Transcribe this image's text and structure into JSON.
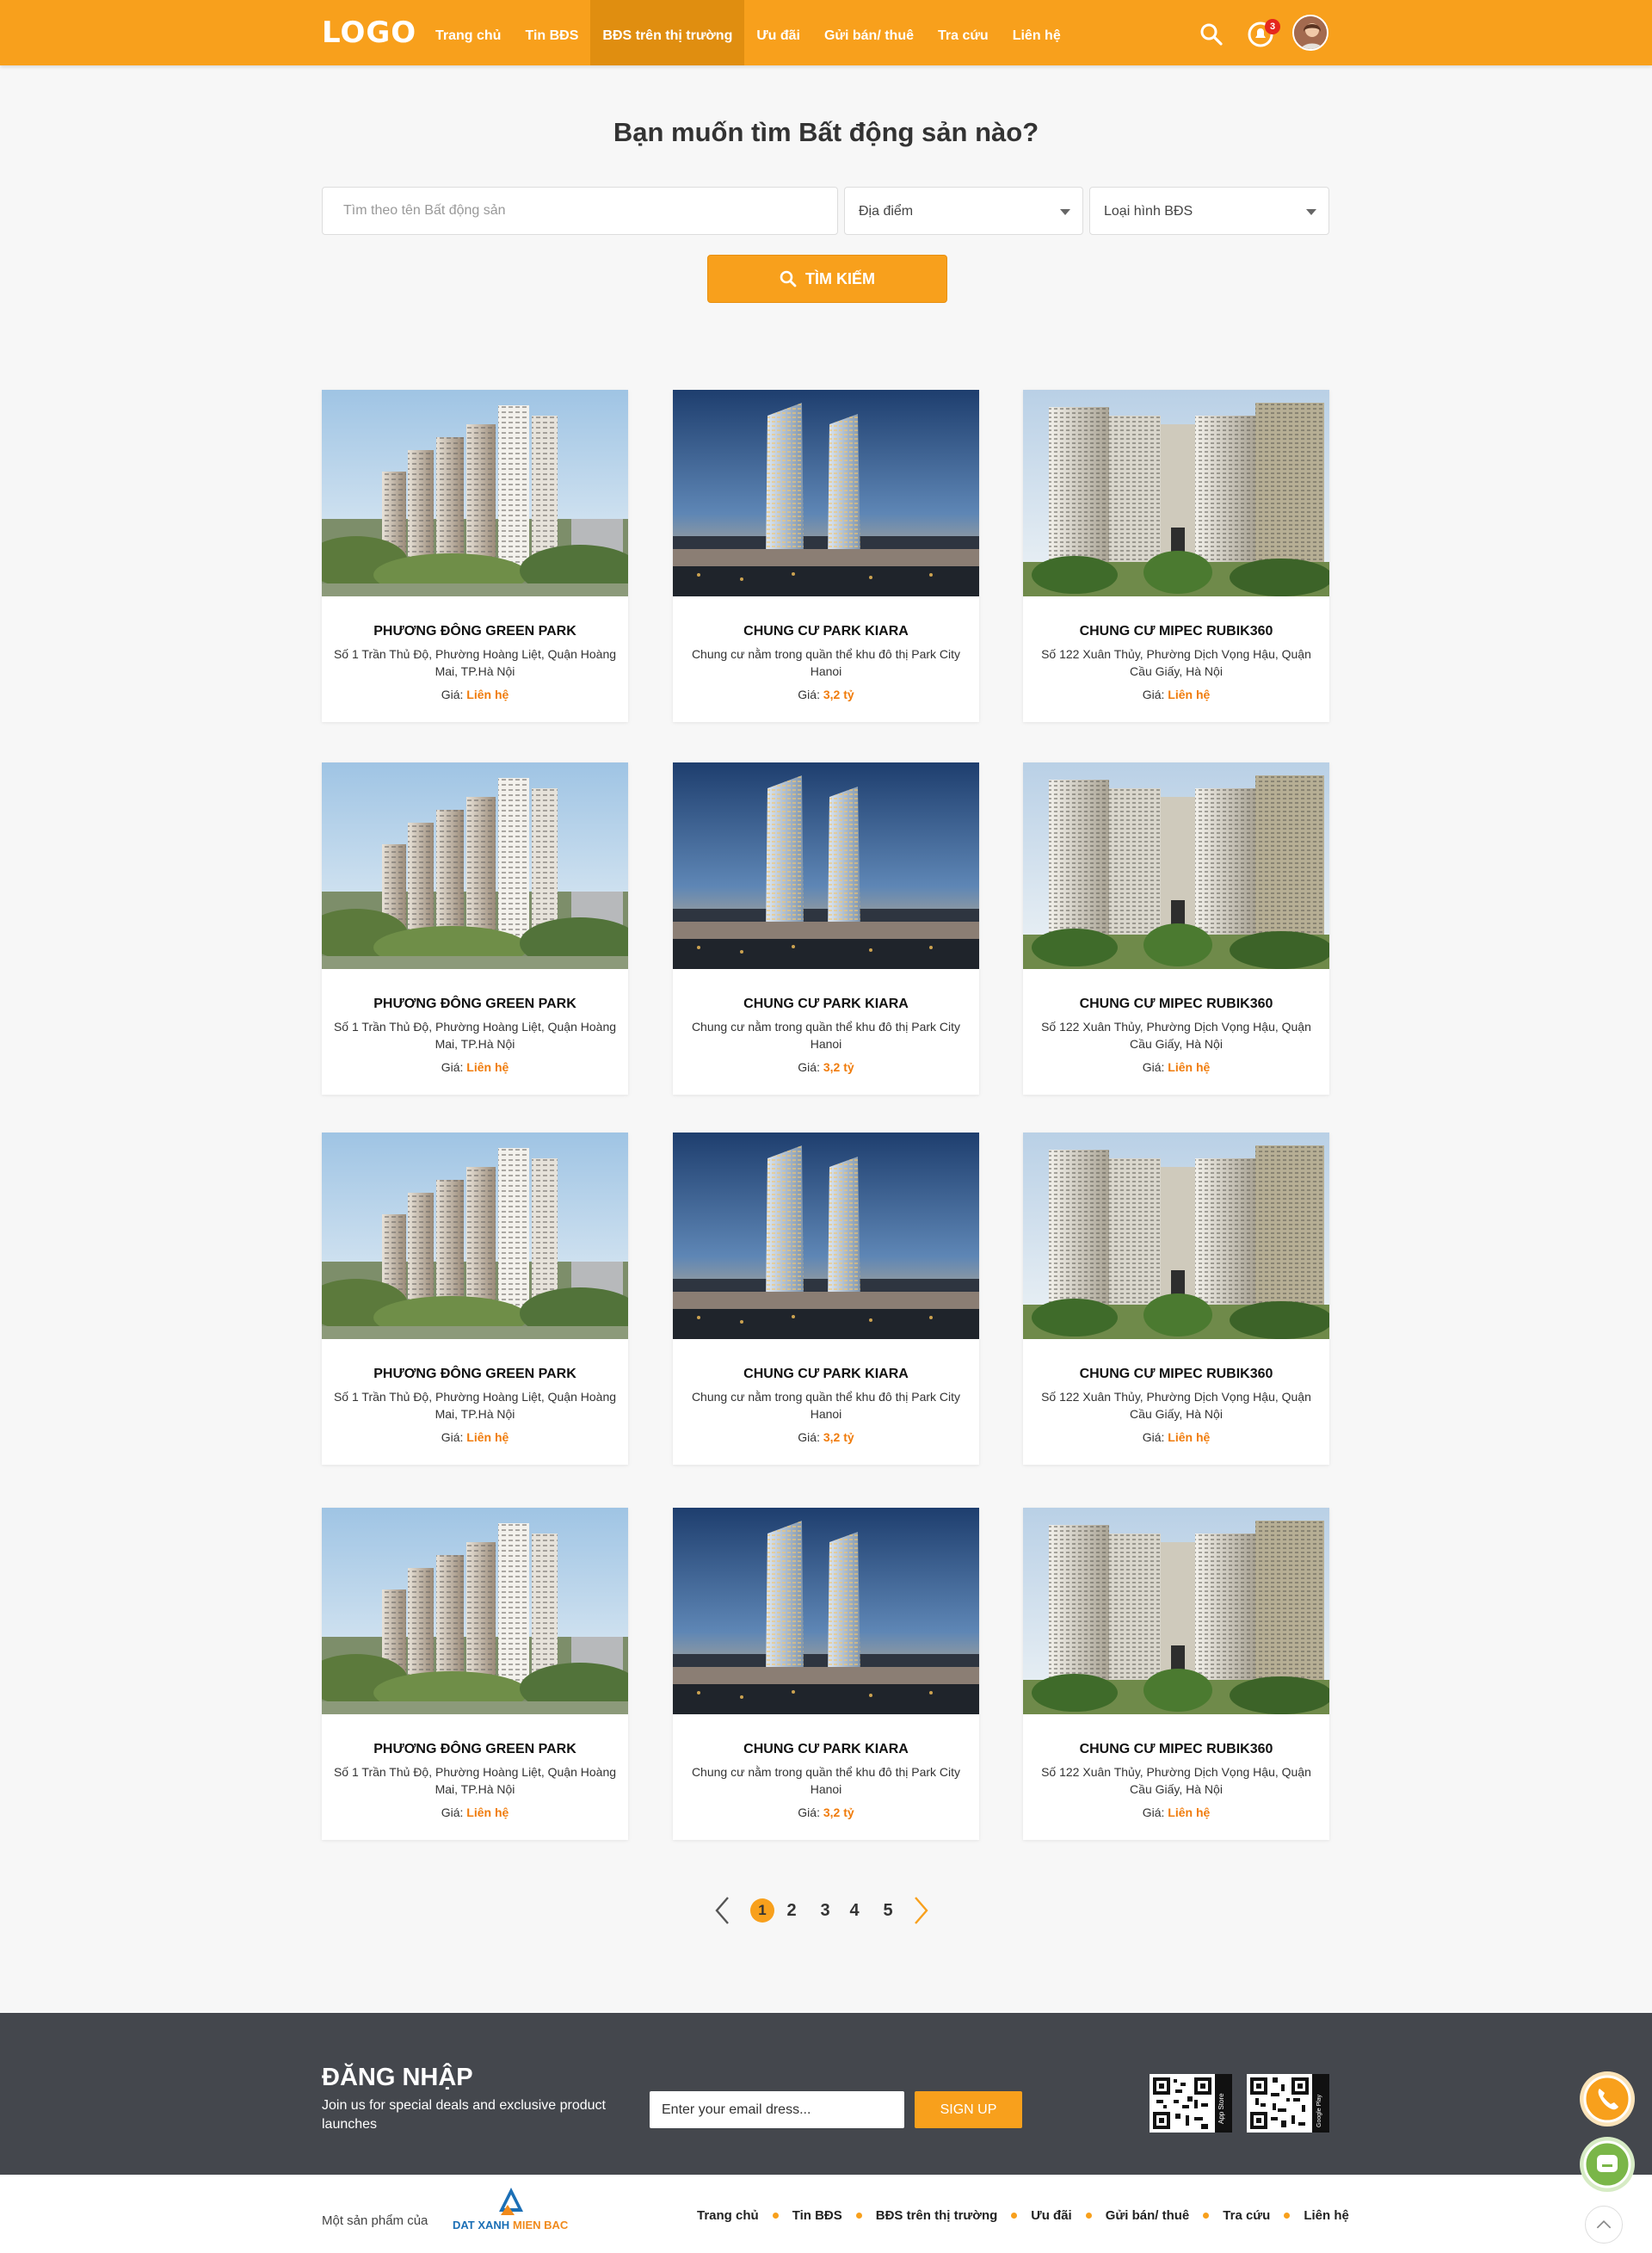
{
  "header": {
    "logo": "LOGO",
    "nav": [
      "Trang chủ",
      "Tin BĐS",
      "BĐS trên thị trường",
      "Ưu đãi",
      "Gửi bán/ thuê",
      "Tra cứu",
      "Liên hệ"
    ],
    "active_nav": "BĐS trên thị trường",
    "notification_count": "3"
  },
  "search": {
    "title": "Bạn muốn tìm Bất động sản nào?",
    "placeholder": "Tìm theo tên Bất động sản",
    "location_select": "Địa điểm",
    "type_select": "Loại hình BĐS",
    "button_label": "TÌM KIẾM"
  },
  "listings": [
    {
      "name": "PHƯƠNG ĐÔNG GREEN PARK",
      "desc": "Số 1 Trần Thủ Độ, Phường Hoàng Liệt, Quận Hoàng Mai, TP.Hà Nội",
      "price_label": "Giá:",
      "price": "Liên hệ"
    },
    {
      "name": "CHUNG CƯ PARK KIARA",
      "desc": "Chung cư nằm trong quần thể khu đô thị Park City Hanoi",
      "price_label": "Giá:",
      "price": "3,2 tỷ"
    },
    {
      "name": "CHUNG CƯ MIPEC RUBIK360",
      "desc": "Số 122 Xuân Thủy, Phường Dịch Vọng Hậu, Quận Cầu Giấy, Hà Nội",
      "price_label": "Giá:",
      "price": "Liên hệ"
    },
    {
      "name": "PHƯƠNG ĐÔNG GREEN PARK",
      "desc": "Số 1 Trần Thủ Độ, Phường Hoàng Liệt, Quận Hoàng Mai, TP.Hà Nội",
      "price_label": "Giá:",
      "price": "Liên hệ"
    },
    {
      "name": "CHUNG CƯ PARK KIARA",
      "desc": "Chung cư nằm trong quần thể khu đô thị Park City Hanoi",
      "price_label": "Giá:",
      "price": "3,2 tỷ"
    },
    {
      "name": "CHUNG CƯ MIPEC RUBIK360",
      "desc": "Số 122 Xuân Thủy, Phường Dịch Vọng Hậu, Quận Cầu Giấy, Hà Nội",
      "price_label": "Giá:",
      "price": "Liên hệ"
    },
    {
      "name": "PHƯƠNG ĐÔNG GREEN PARK",
      "desc": "Số 1 Trần Thủ Độ, Phường Hoàng Liệt, Quận Hoàng Mai, TP.Hà Nội",
      "price_label": "Giá:",
      "price": "Liên hệ"
    },
    {
      "name": "CHUNG CƯ PARK KIARA",
      "desc": "Chung cư nằm trong quần thể khu đô thị Park City Hanoi",
      "price_label": "Giá:",
      "price": "3,2 tỷ"
    },
    {
      "name": "CHUNG CƯ MIPEC RUBIK360",
      "desc": "Số 122 Xuân Thủy, Phường Dịch Vọng Hậu, Quận Cầu Giấy, Hà Nội",
      "price_label": "Giá:",
      "price": "Liên hệ"
    },
    {
      "name": "PHƯƠNG ĐÔNG GREEN PARK",
      "desc": "Số 1 Trần Thủ Độ, Phường Hoàng Liệt, Quận Hoàng Mai, TP.Hà Nội",
      "price_label": "Giá:",
      "price": "Liên hệ"
    },
    {
      "name": "CHUNG CƯ PARK KIARA",
      "desc": "Chung cư nằm trong quần thể khu đô thị Park City Hanoi",
      "price_label": "Giá:",
      "price": "3,2 tỷ"
    },
    {
      "name": "CHUNG CƯ MIPEC RUBIK360",
      "desc": "Số 122 Xuân Thủy, Phường Dịch Vọng Hậu, Quận Cầu Giấy, Hà Nội",
      "price_label": "Giá:",
      "price": "Liên hệ"
    }
  ],
  "pagination": {
    "pages": [
      "1",
      "2",
      "3",
      "4",
      "5"
    ],
    "current": "1"
  },
  "footer": {
    "title": "ĐĂNG NHẬP",
    "subtitle": "Join us for special deals and exclusive product launches",
    "email_placeholder": "Enter your email dress...",
    "signup_label": "SIGN UP",
    "app_store": "App Store",
    "google_play": "Google Play"
  },
  "bottom": {
    "made_by": "Một sản phẩm của",
    "brand": "DAT XANH MIEN BAC",
    "brand_part1": "DAT XANH",
    "brand_part2": "MIEN BAC",
    "nav": [
      "Trang chủ",
      "Tin BĐS",
      "BĐS trên thị trường",
      "Ưu đãi",
      "Gửi bán/ thuê",
      "Tra cứu",
      "Liên hệ"
    ]
  },
  "colors": {
    "accent": "#f8a01c",
    "price": "#f07c0c",
    "footer_bg": "#44474d",
    "call_button": "#f8a01c",
    "chat_button": "#7ab648"
  },
  "icons": [
    "search-icon",
    "bell-icon",
    "chevron-left-icon",
    "chevron-right-icon",
    "phone-icon",
    "chat-icon",
    "chevron-up-icon",
    "qr-code-icon"
  ]
}
